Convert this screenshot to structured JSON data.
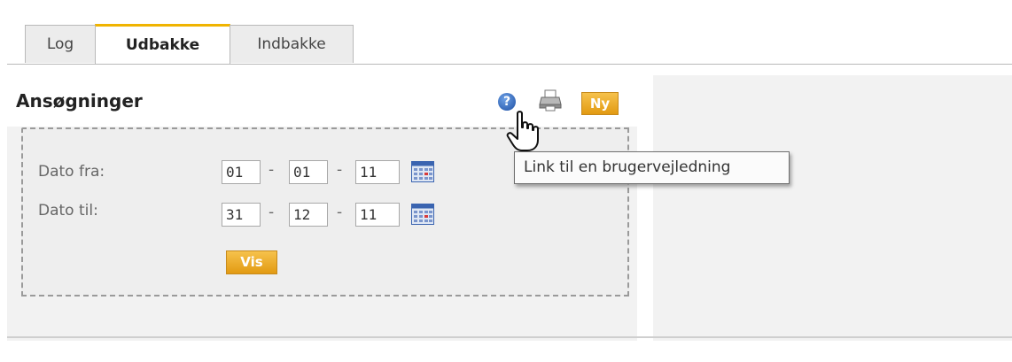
{
  "tabs": [
    {
      "label": "Log",
      "active": false
    },
    {
      "label": "Udbakke",
      "active": true
    },
    {
      "label": "Indbakke",
      "active": false
    }
  ],
  "panel": {
    "title": "Ansøgninger",
    "new_button": "Ny",
    "help_icon": "help-icon",
    "print_icon": "printer-icon",
    "help_glyph": "?"
  },
  "filter": {
    "from_label": "Dato fra:",
    "to_label": "Dato til:",
    "from": {
      "day": "01",
      "month": "01",
      "year": "11"
    },
    "to": {
      "day": "31",
      "month": "12",
      "year": "11"
    },
    "separator": "-",
    "show_button": "Vis",
    "calendar_icon": "calendar-icon"
  },
  "tooltip": "Link til en brugervejledning",
  "colors": {
    "accent": "#f0b400",
    "button": "#e8a522",
    "panel_bg": "#f2f2f2"
  }
}
